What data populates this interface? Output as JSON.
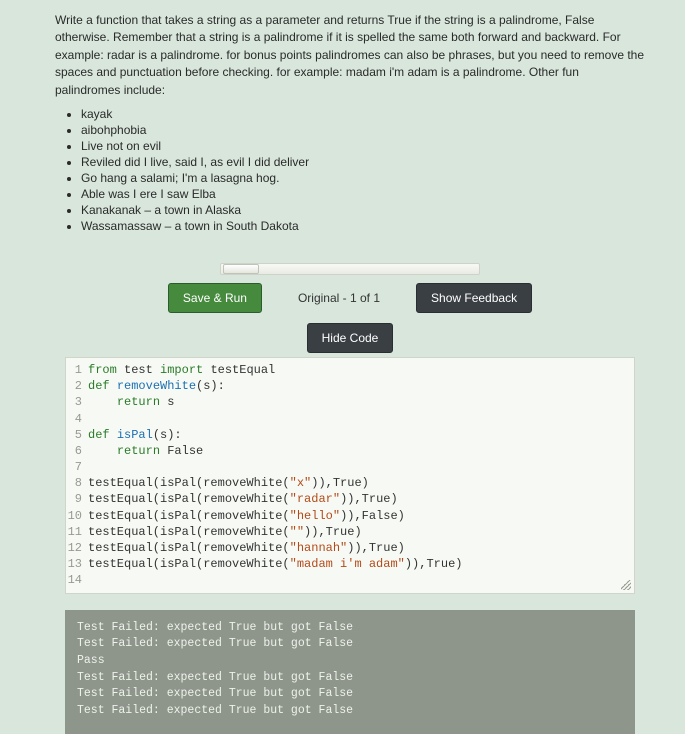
{
  "question": {
    "text": "Write a function that takes a string as a parameter and returns True if the string is a palindrome, False otherwise. Remember that a string is a palindrome if it is spelled the same both forward and backward. For example: radar is a palindrome. for bonus points palindromes can also be phrases, but you need to remove the spaces and punctuation before checking. for example: madam i'm adam is a palindrome. Other fun palindromes include:",
    "examples": [
      "kayak",
      "aibohphobia",
      "Live not on evil",
      "Reviled did I live, said I, as evil I did deliver",
      "Go hang a salami; I'm a lasagna hog.",
      "Able was I ere I saw Elba",
      "Kanakanak – a town in Alaska",
      "Wassamassaw – a town in South Dakota"
    ]
  },
  "toolbar": {
    "save_run": "Save & Run",
    "pager": "Original - 1 of 1",
    "feedback": "Show Feedback",
    "hide_code": "Hide Code"
  },
  "code": {
    "lines": [
      {
        "n": "1",
        "seg": [
          [
            "kw",
            "from"
          ],
          [
            "",
            " test "
          ],
          [
            "kw",
            "import"
          ],
          [
            "",
            " testEqual"
          ]
        ]
      },
      {
        "n": "2",
        "seg": [
          [
            "kw",
            "def"
          ],
          [
            "",
            " "
          ],
          [
            "fn",
            "removeWhite"
          ],
          [
            "",
            "(s):"
          ]
        ]
      },
      {
        "n": "3",
        "seg": [
          [
            "",
            "    "
          ],
          [
            "kw",
            "return"
          ],
          [
            "",
            " s"
          ]
        ]
      },
      {
        "n": "4",
        "seg": [
          [
            "",
            ""
          ]
        ]
      },
      {
        "n": "5",
        "seg": [
          [
            "kw",
            "def"
          ],
          [
            "",
            " "
          ],
          [
            "fn",
            "isPal"
          ],
          [
            "",
            "(s):"
          ]
        ]
      },
      {
        "n": "6",
        "seg": [
          [
            "",
            "    "
          ],
          [
            "kw",
            "return"
          ],
          [
            "",
            " False"
          ]
        ]
      },
      {
        "n": "7",
        "seg": [
          [
            "",
            ""
          ]
        ]
      },
      {
        "n": "8",
        "seg": [
          [
            "",
            "testEqual(isPal(removeWhite("
          ],
          [
            "str",
            "\"x\""
          ],
          [
            "",
            ")),True)"
          ]
        ]
      },
      {
        "n": "9",
        "seg": [
          [
            "",
            "testEqual(isPal(removeWhite("
          ],
          [
            "str",
            "\"radar\""
          ],
          [
            "",
            ")),True)"
          ]
        ]
      },
      {
        "n": "10",
        "seg": [
          [
            "",
            "testEqual(isPal(removeWhite("
          ],
          [
            "str",
            "\"hello\""
          ],
          [
            "",
            ")),False)"
          ]
        ]
      },
      {
        "n": "11",
        "seg": [
          [
            "",
            "testEqual(isPal(removeWhite("
          ],
          [
            "str",
            "\"\""
          ],
          [
            "",
            ")),True)"
          ]
        ]
      },
      {
        "n": "12",
        "seg": [
          [
            "",
            "testEqual(isPal(removeWhite("
          ],
          [
            "str",
            "\"hannah\""
          ],
          [
            "",
            ")),True)"
          ]
        ]
      },
      {
        "n": "13",
        "seg": [
          [
            "",
            "testEqual(isPal(removeWhite("
          ],
          [
            "str",
            "\"madam i'm adam\""
          ],
          [
            "",
            ")),True)"
          ]
        ]
      },
      {
        "n": "14",
        "seg": [
          [
            "",
            ""
          ]
        ]
      }
    ]
  },
  "output": [
    "Test Failed: expected True but got False",
    "Test Failed: expected True but got False",
    "Pass",
    "Test Failed: expected True but got False",
    "Test Failed: expected True but got False",
    "Test Failed: expected True but got False"
  ]
}
